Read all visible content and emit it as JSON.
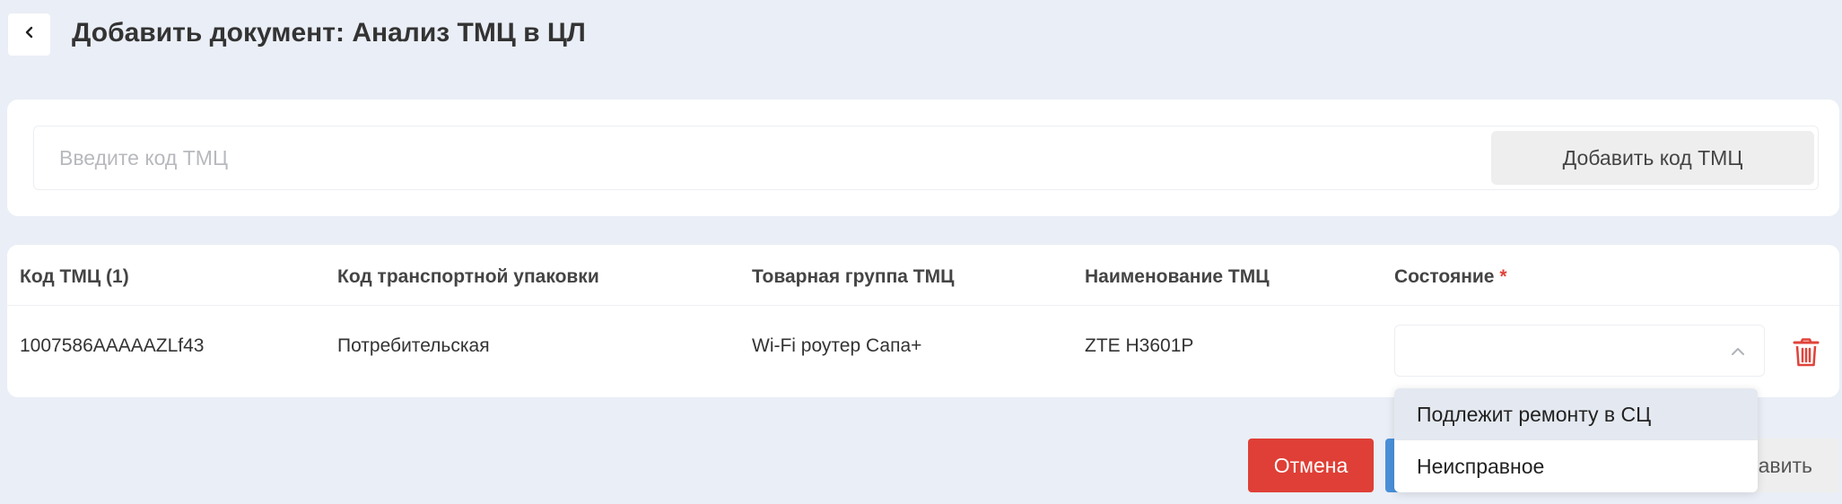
{
  "header": {
    "back_icon": "chevron-left-icon",
    "title": "Добавить документ: Анализ ТМЦ в ЦЛ"
  },
  "search": {
    "placeholder": "Введите код ТМЦ",
    "value": "",
    "add_button_label": "Добавить код ТМЦ"
  },
  "table": {
    "columns": [
      {
        "label": "Код ТМЦ (1)"
      },
      {
        "label": "Код транспортной упаковки"
      },
      {
        "label": "Товарная группа ТМЦ"
      },
      {
        "label": "Наименование ТМЦ"
      },
      {
        "label": "Состояние",
        "required_mark": "*"
      }
    ],
    "rows": [
      {
        "code": "1007586AAAAAZLf43",
        "packaging": "Потребительская",
        "group": "Wi-Fi роутер Сапа+",
        "name": "ZTE H3601P",
        "state": ""
      }
    ],
    "delete_icon": "trash-icon"
  },
  "state_dropdown": {
    "open": true,
    "options": [
      "Подлежит ремонту в СЦ",
      "Неисправное"
    ],
    "highlighted_index": 0
  },
  "footer": {
    "cancel_label": "Отмена",
    "save_label_visible": "авить"
  },
  "colors": {
    "background": "#eaeef6",
    "danger": "#df3f36",
    "primary": "#4a90d9",
    "required": "#e0433a"
  }
}
